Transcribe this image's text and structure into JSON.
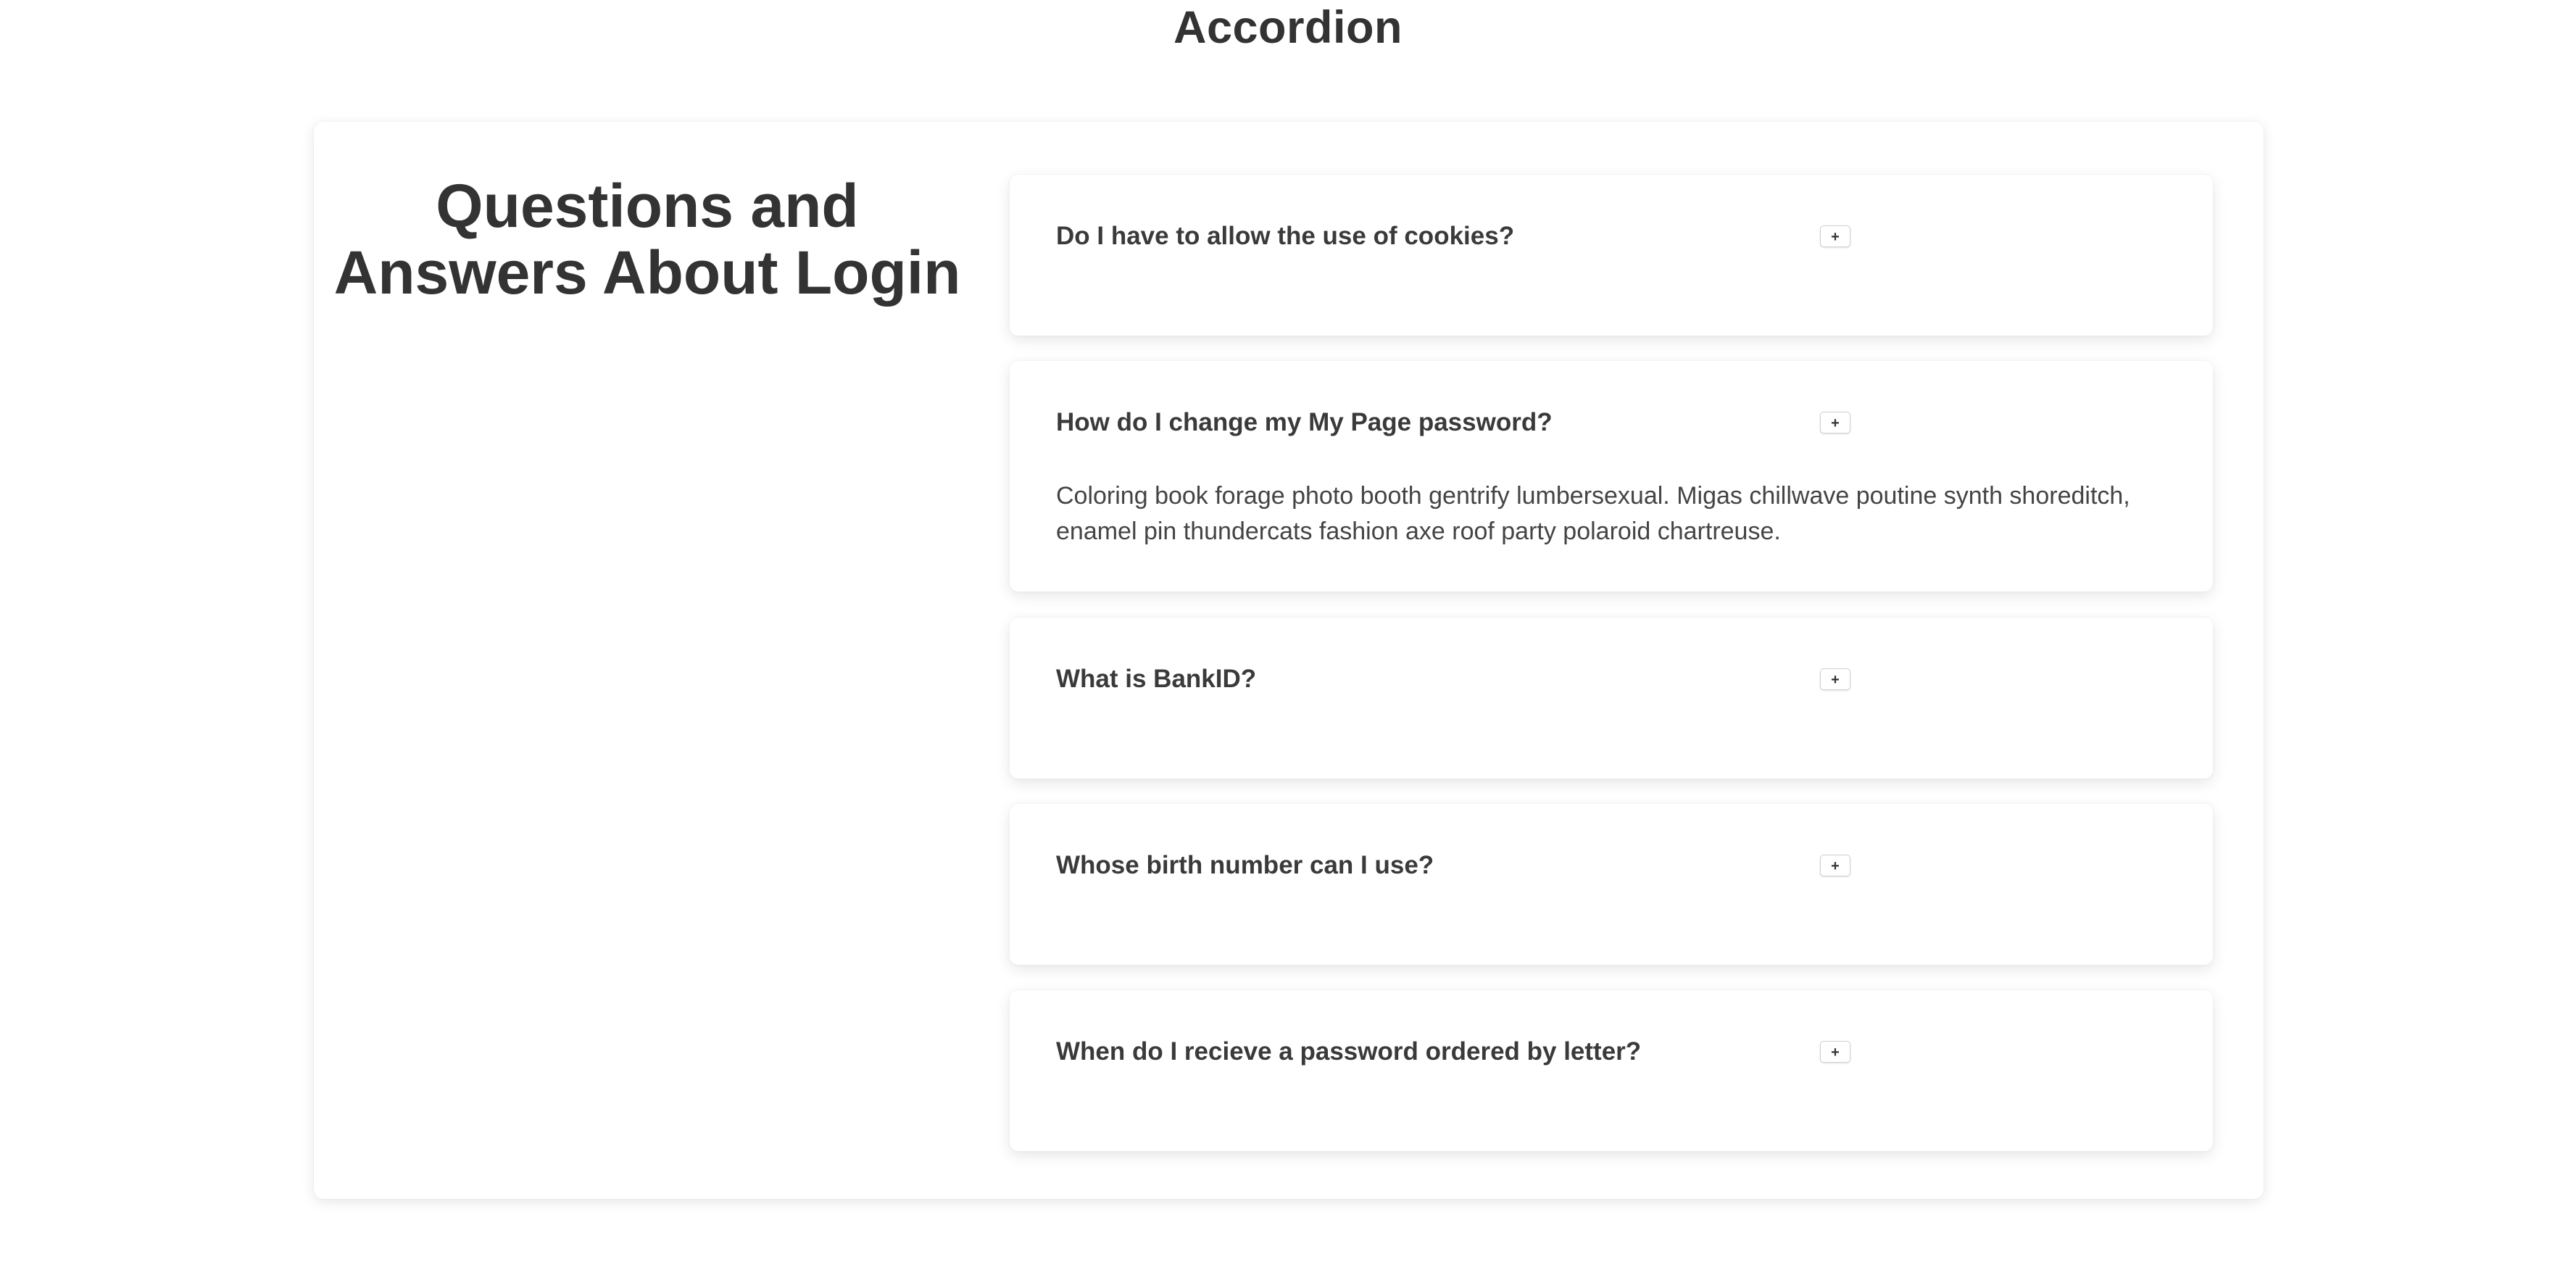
{
  "page": {
    "title": "Accordion"
  },
  "faq": {
    "heading": "Questions and Answers About Login",
    "toggle_symbol": "+",
    "items": [
      {
        "question": "Do I have to allow the use of cookies?",
        "expanded": false
      },
      {
        "question": "How do I change my My Page password?",
        "answer": "Coloring book forage photo booth gentrify lumbersexual. Migas chillwave poutine synth shoreditch, enamel pin thundercats fashion axe roof party polaroid chartreuse.",
        "expanded": true
      },
      {
        "question": "What is BankID?",
        "expanded": false
      },
      {
        "question": "Whose birth number can I use?",
        "expanded": false
      },
      {
        "question": "When do I recieve a password ordered by letter?",
        "expanded": false
      }
    ]
  },
  "colors": {
    "text": "#333333",
    "background": "#ffffff",
    "button_border": "#d0d0d0"
  }
}
